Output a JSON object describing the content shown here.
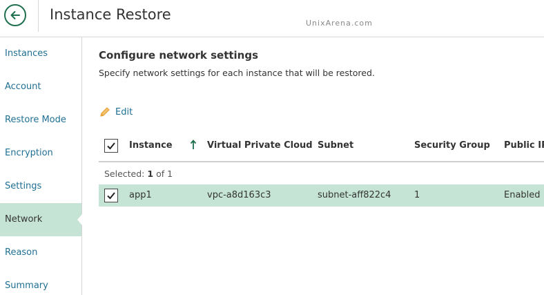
{
  "header": {
    "title": "Instance Restore",
    "watermark": "UnixArena.com"
  },
  "sidebar": {
    "items": [
      {
        "label": "Instances",
        "active": false
      },
      {
        "label": "Account",
        "active": false
      },
      {
        "label": "Restore Mode",
        "active": false
      },
      {
        "label": "Encryption",
        "active": false
      },
      {
        "label": "Settings",
        "active": false
      },
      {
        "label": "Network",
        "active": true
      },
      {
        "label": "Reason",
        "active": false
      },
      {
        "label": "Summary",
        "active": false
      }
    ]
  },
  "main": {
    "section_title": "Configure network settings",
    "section_desc": "Specify network settings for each instance that will be restored.",
    "edit_label": "Edit"
  },
  "table": {
    "columns": [
      "Instance",
      "Virtual Private Cloud",
      "Subnet",
      "Security Group",
      "Public IP"
    ],
    "sort_column": "Instance",
    "sort_direction": "ascending",
    "selected_label": "Selected:",
    "selected_count": "1",
    "selected_of": "of 1",
    "rows": [
      {
        "checked": true,
        "cells": [
          "app1",
          "vpc-a8d163c3",
          "subnet-aff822c4",
          "1",
          "Enabled"
        ]
      }
    ]
  },
  "colors": {
    "accent": "#1f6f4f",
    "link": "#1f6f94",
    "selection": "#c5e4d6",
    "edit_icon": "#e8a23a"
  },
  "icons": {
    "back": "arrow-left-icon",
    "edit": "pencil-icon",
    "sort": "arrow-up-icon",
    "check": "checkmark-icon"
  }
}
